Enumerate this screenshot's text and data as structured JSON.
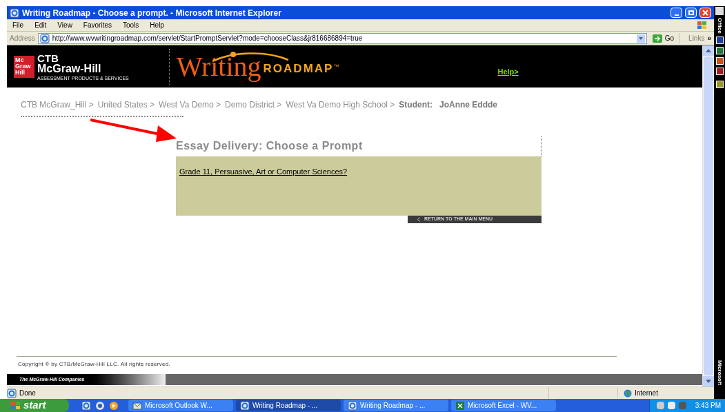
{
  "window": {
    "title": "Writing Roadmap - Choose a prompt. - Microsoft Internet Explorer"
  },
  "menu": [
    "File",
    "Edit",
    "View",
    "Favorites",
    "Tools",
    "Help"
  ],
  "address": {
    "label": "Address",
    "url": "http://www.wvwritingroadmap.com/servlet/StartPromptServlet?mode=chooseClass&jr816686894=true",
    "go": "Go",
    "links": "Links",
    "more": "»"
  },
  "header": {
    "mcgraw_mark": [
      "Mc",
      "Graw",
      "Hill"
    ],
    "brand_top": "CTB",
    "brand_name": "McGraw-Hill",
    "brand_sub": "ASSESSMENT PRODUCTS & SERVICES",
    "logo_script": "Writing",
    "logo_caps": "ROADMAP",
    "logo_tm": "™",
    "help": "Help>"
  },
  "breadcrumb": {
    "items": [
      "CTB McGraw_Hill >",
      "United States >",
      "West Va Demo >",
      "Demo District >",
      "West Va Demo High School >"
    ],
    "student_label": "Student:",
    "student_name": "JoAnne Eddde"
  },
  "heading": "Essay Delivery: Choose a Prompt",
  "prompts": [
    {
      "text": "Grade 11, Persuasive, Art or Computer Sciences?"
    }
  ],
  "return_button": "RETURN TO THE MAIN MENU",
  "copyright": "Copyright ® by CTB/McGraw-Hill LLC. All rights reserved.",
  "footer_brand": "The McGraw-Hill Companies",
  "status": {
    "text": "Done",
    "zone": "Internet"
  },
  "taskbar": {
    "start": "start",
    "tasks": [
      {
        "label": "Microsoft Outlook W...",
        "selected": false,
        "kind": "outlook"
      },
      {
        "label": "Writing Roadmap - ...",
        "selected": true,
        "kind": "ie"
      },
      {
        "label": "Writing Roadmap - ...",
        "selected": false,
        "kind": "ie"
      },
      {
        "label": "Microsoft Excel - WV...",
        "selected": false,
        "kind": "excel"
      }
    ],
    "clock": "3:43 PM"
  },
  "office_bar": {
    "top": "Office",
    "bottom": "Microsoft"
  }
}
